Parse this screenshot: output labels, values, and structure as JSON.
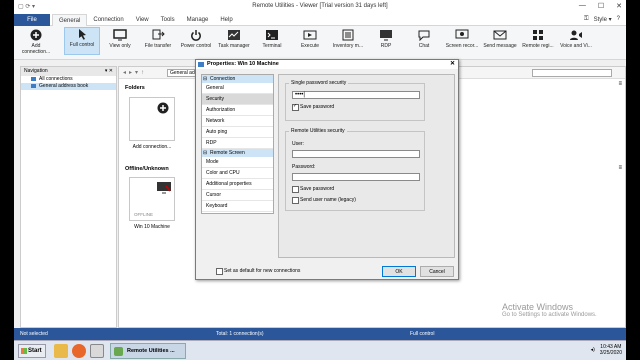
{
  "window": {
    "title": "Remote Utilities - Viewer [Trial version 31 days left]",
    "quick_access": "▢ ⟳ ▾"
  },
  "menu": {
    "file": "File",
    "tabs": [
      "General",
      "Connection",
      "View",
      "Tools",
      "Manage",
      "Help"
    ],
    "right_items": [
      "⚿",
      "Style ▾",
      "?"
    ]
  },
  "ribbon": {
    "add_connection": "Add connection...",
    "buttons": [
      "Full control",
      "View only",
      "File transfer",
      "Power control",
      "Task manager",
      "Terminal",
      "Execute",
      "Inventory m...",
      "RDP",
      "Chat",
      "Screen recor...",
      "Send message",
      "Remote regi...",
      "Voice and Vi..."
    ]
  },
  "navigation": {
    "title": "Navigation",
    "items": [
      "All connections",
      "General address book"
    ]
  },
  "address_bar": {
    "value": "General address"
  },
  "main": {
    "folders_label": "Folders",
    "add_connection_label": "Add connection...",
    "offline_label": "Offline/Unknown",
    "machine_status": "OFFLINE",
    "machine_name": "Win 10 Machine"
  },
  "dialog": {
    "title": "Properties: Win 10 Machine",
    "close": "✕",
    "group_connection": "Connection",
    "connection_items": [
      "General",
      "Security",
      "Authorization",
      "Network",
      "Auto ping",
      "RDP"
    ],
    "group_remote_screen": "Remote Screen",
    "remote_items": [
      "Mode",
      "Color and CPU",
      "Additional properties",
      "Cursor",
      "Keyboard"
    ],
    "single_pw_legend": "Single password security",
    "password_mask": "••••|",
    "save_password": "Save password",
    "ru_security_legend": "Remote Utilities security",
    "user_label": "User:",
    "password_label": "Password:",
    "save_password2": "Save password",
    "send_user_name": "Send user name (legacy)",
    "set_default": "Set as default for new connections",
    "ok": "OK",
    "cancel": "Cancel"
  },
  "watermark": {
    "line1": "Activate Windows",
    "line2": "Go to Settings to activate Windows."
  },
  "status": {
    "left": "Not selected",
    "center": "Total: 1 connection(s)",
    "right": "Full control"
  },
  "taskbar": {
    "start": "Start",
    "task": "Remote Utilities ...",
    "time": "10:43 AM",
    "date": "3/25/2020"
  },
  "colors": {
    "accent": "#2b579a",
    "selection": "#cde4f7"
  }
}
